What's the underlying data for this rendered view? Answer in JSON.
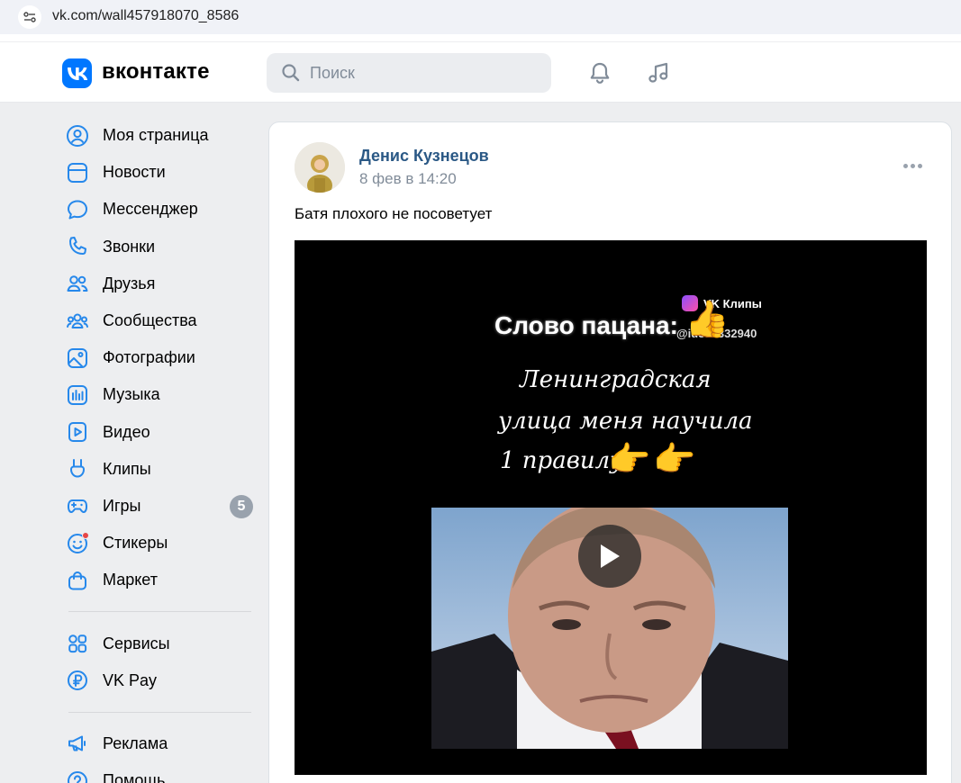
{
  "browser": {
    "url": "vk.com/wall457918070_8586"
  },
  "header": {
    "logo_text": "вконтакте",
    "search_placeholder": "Поиск"
  },
  "sidebar": {
    "items": [
      {
        "label": "Моя страница",
        "icon": "profile-icon"
      },
      {
        "label": "Новости",
        "icon": "news-icon"
      },
      {
        "label": "Мессенджер",
        "icon": "messenger-icon"
      },
      {
        "label": "Звонки",
        "icon": "phone-icon"
      },
      {
        "label": "Друзья",
        "icon": "friends-icon"
      },
      {
        "label": "Сообщества",
        "icon": "communities-icon"
      },
      {
        "label": "Фотографии",
        "icon": "photos-icon"
      },
      {
        "label": "Музыка",
        "icon": "music-icon"
      },
      {
        "label": "Видео",
        "icon": "video-icon"
      },
      {
        "label": "Клипы",
        "icon": "clips-icon"
      },
      {
        "label": "Игры",
        "icon": "games-icon",
        "badge": "5"
      },
      {
        "label": "Стикеры",
        "icon": "stickers-icon"
      },
      {
        "label": "Маркет",
        "icon": "market-icon"
      }
    ],
    "secondary": [
      {
        "label": "Сервисы",
        "icon": "services-icon"
      },
      {
        "label": "VK Pay",
        "icon": "vkpay-icon"
      }
    ],
    "tertiary": [
      {
        "label": "Реклама",
        "icon": "ads-icon"
      },
      {
        "label": "Помощь",
        "icon": "help-icon"
      }
    ]
  },
  "post": {
    "author": "Денис Кузнецов",
    "date": "8 фев в 14:20",
    "text": "Батя плохого не посоветует",
    "video": {
      "clips_label": "VK Клипы",
      "clips_id": "@id375332940",
      "headline": "Слово пацана:",
      "line1": "Ленинградская",
      "line2": "улица меня научила",
      "line3": "1 правилу"
    }
  },
  "colors": {
    "brand": "#0077ff",
    "link": "#2a5885",
    "muted": "#818c99",
    "background": "#edeef0"
  }
}
